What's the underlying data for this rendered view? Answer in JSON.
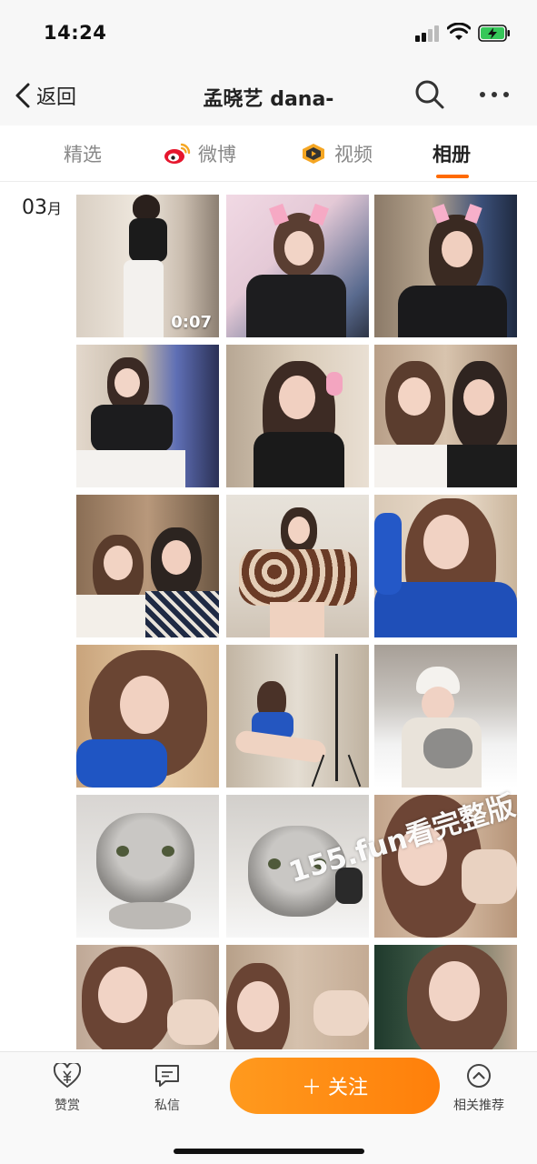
{
  "status_bar": {
    "time": "14:24"
  },
  "nav": {
    "back_label": "返回",
    "title": "孟晓艺 dana-"
  },
  "tabs": [
    {
      "label": "精选",
      "icon": "none",
      "active": false
    },
    {
      "label": "微博",
      "icon": "weibo-logo-icon",
      "active": false
    },
    {
      "label": "视频",
      "icon": "video-channel-icon",
      "active": false
    },
    {
      "label": "相册",
      "icon": "none",
      "active": true
    }
  ],
  "album": {
    "month_number": "03",
    "month_unit": "月",
    "video_duration": "0:07",
    "watermark": "155.fun看完整版",
    "photos": [
      "girl-dancing-video",
      "girl-pink-cat-headphones-gaming",
      "girl-pink-cat-headphones-closeup",
      "girl-headphones-at-pc",
      "girl-headphones-portrait",
      "two-girls-selfie",
      "two-girls-peace-sign",
      "girl-brown-camo-top",
      "girl-blue-cardigan-selfie",
      "girl-blue-cardigan-closeup",
      "girl-mirror-selfie-tripod",
      "girl-white-hat-holding-cat-snow",
      "grey-cat-in-snow",
      "grey-cat-in-snow-2",
      "girl-lying-selfie",
      "girl-lying-pout-1",
      "girl-lying-pout-2",
      "girl-lying-pout-3"
    ]
  },
  "bottom_bar": {
    "reward_label": "赞赏",
    "message_label": "私信",
    "follow_label": "＋ 关注",
    "related_label": "相关推荐"
  },
  "colors": {
    "accent": "#ff7f0a",
    "tab_active": "#222222",
    "tab_inactive": "#888888"
  }
}
